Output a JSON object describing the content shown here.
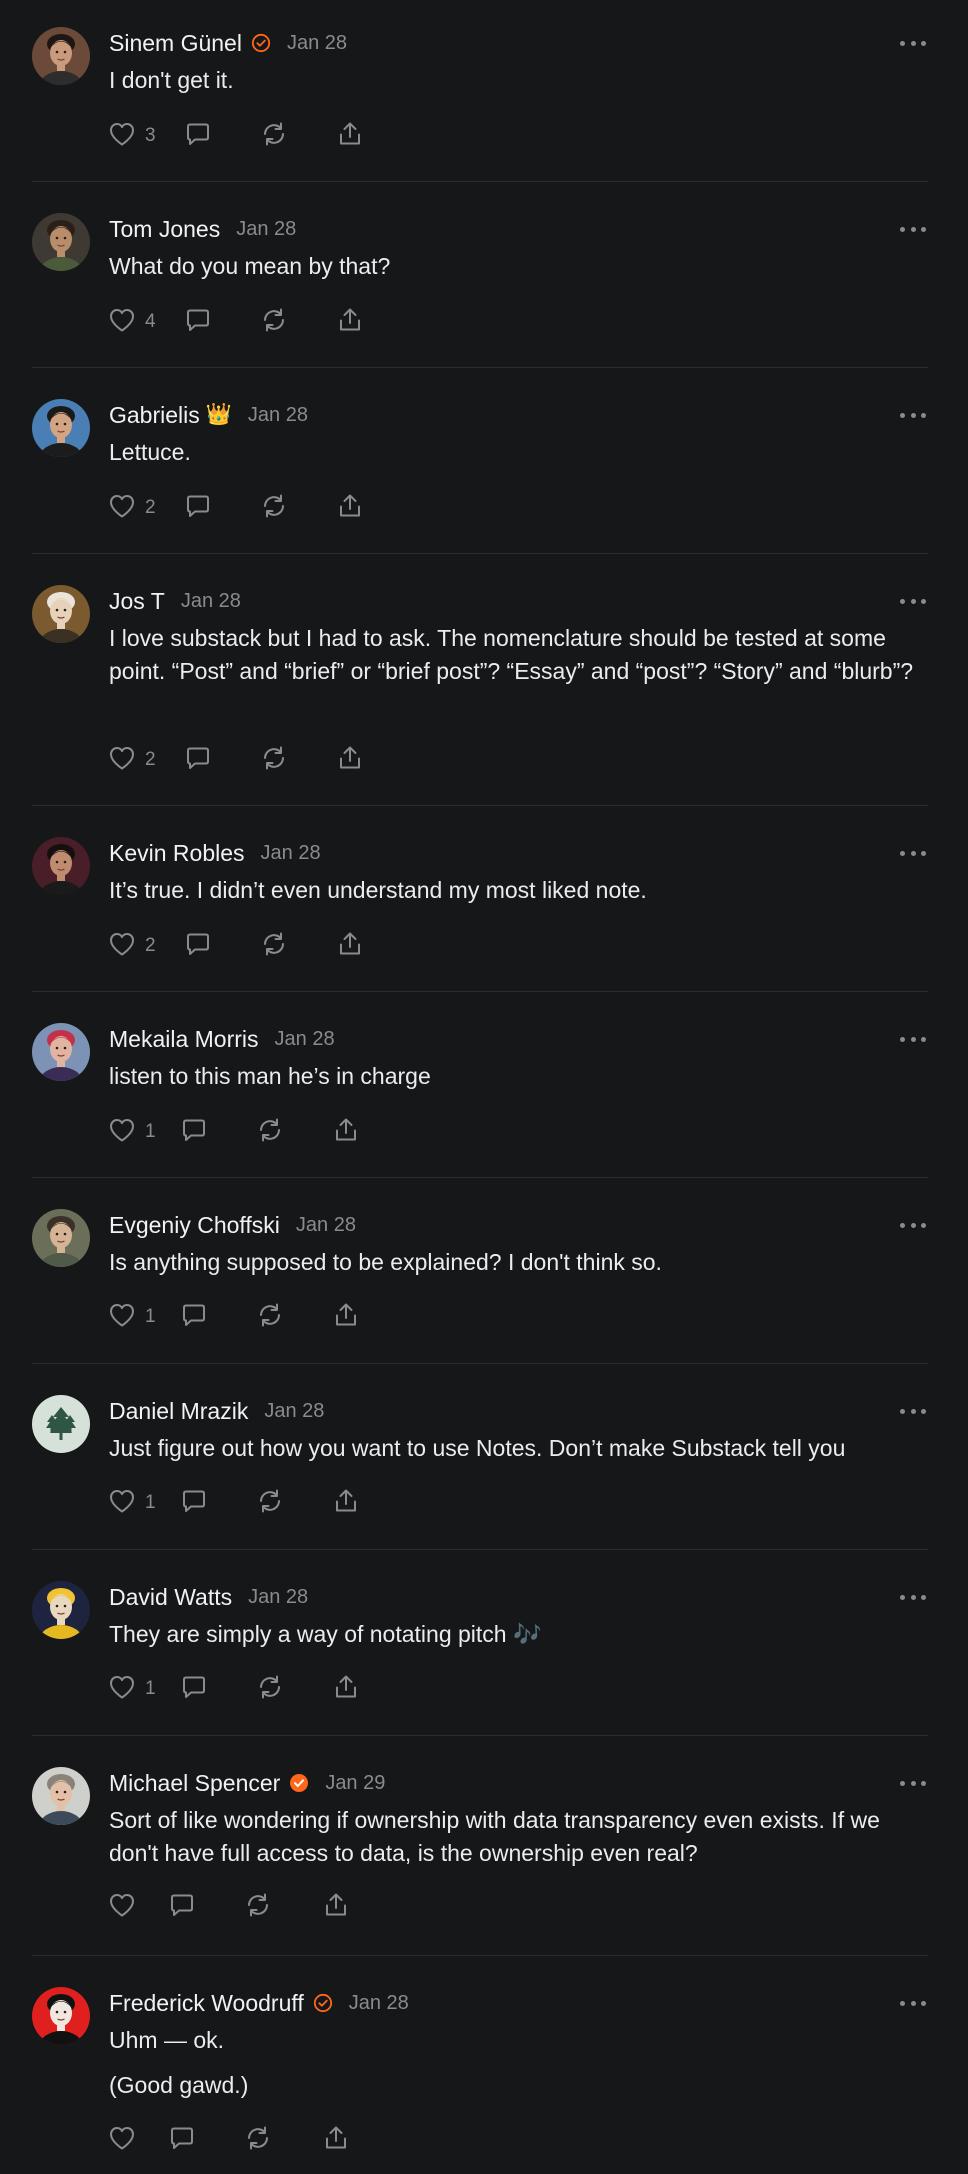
{
  "comments": [
    {
      "name": "Sinem Günel",
      "emoji": "",
      "verified": "outline",
      "date": "Jan 28",
      "text": [
        "I don't get it."
      ],
      "likes": "3",
      "avatar": {
        "bg": "#6b4a3a",
        "skin": "#c99a7c",
        "hair": "#1f1512",
        "shirt": "#2d2d2d"
      }
    },
    {
      "name": "Tom Jones",
      "emoji": "",
      "verified": "",
      "date": "Jan 28",
      "text": [
        "What do you mean by that?"
      ],
      "likes": "4",
      "avatar": {
        "bg": "#3e3a33",
        "skin": "#b88d6a",
        "hair": "#2b2018",
        "shirt": "#4a5a3a"
      }
    },
    {
      "name": "Gabrielis",
      "emoji": "👑",
      "verified": "",
      "date": "Jan 28",
      "text": [
        "Lettuce."
      ],
      "likes": "2",
      "avatar": {
        "bg": "#4a7fb5",
        "skin": "#d2a484",
        "hair": "#1a1a1a",
        "shirt": "#1c1c1c"
      }
    },
    {
      "name": "Jos T",
      "emoji": "",
      "verified": "",
      "date": "Jan 28",
      "text": [
        "I love substack but I had to ask. The nomenclature should be tested at some point. “Post” and “brief” or “brief post”? “Essay” and “post”? “Story” and “blurb”?"
      ],
      "likes": "2",
      "avatar": {
        "bg": "#7a5a2e",
        "skin": "#e6d2b8",
        "hair": "#eae4da",
        "shirt": "#3a3024"
      }
    },
    {
      "name": "Kevin Robles",
      "emoji": "",
      "verified": "",
      "date": "Jan 28",
      "text": [
        "It’s true. I didn’t even understand my most liked note."
      ],
      "likes": "2",
      "avatar": {
        "bg": "#4a1e28",
        "skin": "#c08c70",
        "hair": "#150f0f",
        "shirt": "#1a1a1a"
      }
    },
    {
      "name": "Mekaila Morris",
      "emoji": "",
      "verified": "",
      "date": "Jan 28",
      "text": [
        "listen to this man he’s in charge"
      ],
      "likes": "1",
      "avatar": {
        "bg": "#7d93b5",
        "skin": "#e0b4a0",
        "hair": "#c2304a",
        "shirt": "#3a2d55"
      }
    },
    {
      "name": "Evgeniy Choffski",
      "emoji": "",
      "verified": "",
      "date": "Jan 28",
      "text": [
        "Is anything supposed to be explained? I don't think so."
      ],
      "likes": "1",
      "avatar": {
        "bg": "#6b6f5a",
        "skin": "#d4b494",
        "hair": "#3a3028",
        "shirt": "#505a48"
      }
    },
    {
      "name": "Daniel Mrazik",
      "emoji": "",
      "verified": "",
      "date": "Jan 28",
      "text": [
        "Just figure out how you want to use Notes. Don’t make Substack tell you"
      ],
      "likes": "1",
      "avatar": {
        "bg": "#d6e1da",
        "skin": "",
        "hair": "#2f5645",
        "shirt": ""
      }
    },
    {
      "name": "David Watts",
      "emoji": "",
      "verified": "",
      "date": "Jan 28",
      "text": [
        "They are simply a way of notating pitch 🎶"
      ],
      "likes": "1",
      "avatar": {
        "bg": "#1e2440",
        "skin": "#e8d8c0",
        "hair": "#f1c232",
        "shirt": "#e6b820"
      }
    },
    {
      "name": "Michael Spencer",
      "emoji": "",
      "verified": "filled",
      "date": "Jan 29",
      "text": [
        "Sort of like wondering if ownership with data transparency even exists. If we don't have full access to data, is the ownership even real?"
      ],
      "likes": "",
      "avatar": {
        "bg": "#cfd0cc",
        "skin": "#e3c0a8",
        "hair": "#8a8178",
        "shirt": "#3d4a5a"
      }
    },
    {
      "name": "Frederick Woodruff",
      "emoji": "",
      "verified": "outline",
      "date": "Jan 28",
      "text": [
        "Uhm — ok.",
        "(Good gawd.)"
      ],
      "likes": "",
      "avatar": {
        "bg": "#e0201e",
        "skin": "#f0e8e0",
        "hair": "#111111",
        "shirt": "#111111"
      }
    }
  ],
  "colors": {
    "background": "#161719",
    "accent": "#ff6719",
    "muted": "#8a8b8e",
    "divider": "#2c2d30"
  },
  "icons": {
    "more": "more-dots-icon",
    "like": "heart-icon",
    "reply": "comment-bubble-icon",
    "restack": "restack-icon",
    "share": "share-icon",
    "verified": "verified-check-icon"
  }
}
